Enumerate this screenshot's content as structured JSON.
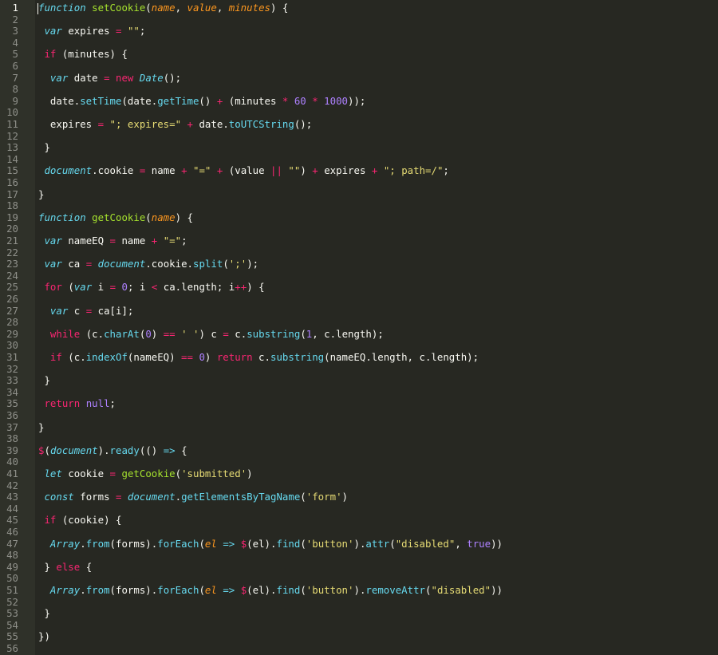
{
  "editor": {
    "theme_colors": {
      "background": "#272822",
      "gutter_background": "#2f3129",
      "line_number": "#8f908a",
      "active_line_number": "#f8f8f2",
      "foreground": "#f8f8f2",
      "keyword": "#f92672",
      "storage": "#66d9ef",
      "entity": "#a6e22e",
      "parameter": "#fd971f",
      "string": "#e6db74",
      "number": "#ae81ff"
    },
    "active_line": 1,
    "lines": [
      {
        "n": "1",
        "tokens": [
          [
            "storage",
            "function"
          ],
          [
            "plain",
            " "
          ],
          [
            "entity",
            "setCookie"
          ],
          [
            "plain",
            "("
          ],
          [
            "param",
            "name"
          ],
          [
            "plain",
            ", "
          ],
          [
            "param",
            "value"
          ],
          [
            "plain",
            ", "
          ],
          [
            "param",
            "minutes"
          ],
          [
            "plain",
            ") {"
          ]
        ]
      },
      {
        "n": "2",
        "tokens": []
      },
      {
        "n": "3",
        "tokens": [
          [
            "plain",
            " "
          ],
          [
            "storage",
            "var"
          ],
          [
            "plain",
            " expires "
          ],
          [
            "keyword",
            "="
          ],
          [
            "plain",
            " "
          ],
          [
            "string",
            "\"\""
          ],
          [
            "plain",
            ";"
          ]
        ]
      },
      {
        "n": "4",
        "tokens": []
      },
      {
        "n": "5",
        "tokens": [
          [
            "plain",
            " "
          ],
          [
            "keyword",
            "if"
          ],
          [
            "plain",
            " (minutes) {"
          ]
        ]
      },
      {
        "n": "6",
        "tokens": []
      },
      {
        "n": "7",
        "tokens": [
          [
            "plain",
            "  "
          ],
          [
            "storage",
            "var"
          ],
          [
            "plain",
            " date "
          ],
          [
            "keyword",
            "="
          ],
          [
            "plain",
            " "
          ],
          [
            "keyword",
            "new"
          ],
          [
            "plain",
            " "
          ],
          [
            "builtin",
            "Date"
          ],
          [
            "plain",
            "();"
          ]
        ]
      },
      {
        "n": "8",
        "tokens": []
      },
      {
        "n": "9",
        "tokens": [
          [
            "plain",
            "  date."
          ],
          [
            "support",
            "setTime"
          ],
          [
            "plain",
            "(date."
          ],
          [
            "support",
            "getTime"
          ],
          [
            "plain",
            "() "
          ],
          [
            "keyword",
            "+"
          ],
          [
            "plain",
            " (minutes "
          ],
          [
            "keyword",
            "*"
          ],
          [
            "plain",
            " "
          ],
          [
            "number",
            "60"
          ],
          [
            "plain",
            " "
          ],
          [
            "keyword",
            "*"
          ],
          [
            "plain",
            " "
          ],
          [
            "number",
            "1000"
          ],
          [
            "plain",
            "));"
          ]
        ]
      },
      {
        "n": "10",
        "tokens": []
      },
      {
        "n": "11",
        "tokens": [
          [
            "plain",
            "  expires "
          ],
          [
            "keyword",
            "="
          ],
          [
            "plain",
            " "
          ],
          [
            "string",
            "\"; expires=\""
          ],
          [
            "plain",
            " "
          ],
          [
            "keyword",
            "+"
          ],
          [
            "plain",
            " date."
          ],
          [
            "support",
            "toUTCString"
          ],
          [
            "plain",
            "();"
          ]
        ]
      },
      {
        "n": "12",
        "tokens": []
      },
      {
        "n": "13",
        "tokens": [
          [
            "plain",
            " }"
          ]
        ]
      },
      {
        "n": "14",
        "tokens": []
      },
      {
        "n": "15",
        "tokens": [
          [
            "plain",
            " "
          ],
          [
            "builtin",
            "document"
          ],
          [
            "plain",
            ".cookie "
          ],
          [
            "keyword",
            "="
          ],
          [
            "plain",
            " name "
          ],
          [
            "keyword",
            "+"
          ],
          [
            "plain",
            " "
          ],
          [
            "string",
            "\"=\""
          ],
          [
            "plain",
            " "
          ],
          [
            "keyword",
            "+"
          ],
          [
            "plain",
            " (value "
          ],
          [
            "keyword",
            "||"
          ],
          [
            "plain",
            " "
          ],
          [
            "string",
            "\"\""
          ],
          [
            "plain",
            ") "
          ],
          [
            "keyword",
            "+"
          ],
          [
            "plain",
            " expires "
          ],
          [
            "keyword",
            "+"
          ],
          [
            "plain",
            " "
          ],
          [
            "string",
            "\"; path=/\""
          ],
          [
            "plain",
            ";"
          ]
        ]
      },
      {
        "n": "16",
        "tokens": []
      },
      {
        "n": "17",
        "tokens": [
          [
            "plain",
            "}"
          ]
        ]
      },
      {
        "n": "18",
        "tokens": []
      },
      {
        "n": "19",
        "tokens": [
          [
            "storage",
            "function"
          ],
          [
            "plain",
            " "
          ],
          [
            "entity",
            "getCookie"
          ],
          [
            "plain",
            "("
          ],
          [
            "param",
            "name"
          ],
          [
            "plain",
            ") {"
          ]
        ]
      },
      {
        "n": "20",
        "tokens": []
      },
      {
        "n": "21",
        "tokens": [
          [
            "plain",
            " "
          ],
          [
            "storage",
            "var"
          ],
          [
            "plain",
            " nameEQ "
          ],
          [
            "keyword",
            "="
          ],
          [
            "plain",
            " name "
          ],
          [
            "keyword",
            "+"
          ],
          [
            "plain",
            " "
          ],
          [
            "string",
            "\"=\""
          ],
          [
            "plain",
            ";"
          ]
        ]
      },
      {
        "n": "22",
        "tokens": []
      },
      {
        "n": "23",
        "tokens": [
          [
            "plain",
            " "
          ],
          [
            "storage",
            "var"
          ],
          [
            "plain",
            " ca "
          ],
          [
            "keyword",
            "="
          ],
          [
            "plain",
            " "
          ],
          [
            "builtin",
            "document"
          ],
          [
            "plain",
            ".cookie."
          ],
          [
            "support",
            "split"
          ],
          [
            "plain",
            "("
          ],
          [
            "string",
            "';'"
          ],
          [
            "plain",
            ");"
          ]
        ]
      },
      {
        "n": "24",
        "tokens": []
      },
      {
        "n": "25",
        "tokens": [
          [
            "plain",
            " "
          ],
          [
            "keyword",
            "for"
          ],
          [
            "plain",
            " ("
          ],
          [
            "storage",
            "var"
          ],
          [
            "plain",
            " i "
          ],
          [
            "keyword",
            "="
          ],
          [
            "plain",
            " "
          ],
          [
            "number",
            "0"
          ],
          [
            "plain",
            "; i "
          ],
          [
            "keyword",
            "<"
          ],
          [
            "plain",
            " ca.length; i"
          ],
          [
            "keyword",
            "++"
          ],
          [
            "plain",
            ") {"
          ]
        ]
      },
      {
        "n": "26",
        "tokens": []
      },
      {
        "n": "27",
        "tokens": [
          [
            "plain",
            "  "
          ],
          [
            "storage",
            "var"
          ],
          [
            "plain",
            " c "
          ],
          [
            "keyword",
            "="
          ],
          [
            "plain",
            " ca[i];"
          ]
        ]
      },
      {
        "n": "28",
        "tokens": []
      },
      {
        "n": "29",
        "tokens": [
          [
            "plain",
            "  "
          ],
          [
            "keyword",
            "while"
          ],
          [
            "plain",
            " (c."
          ],
          [
            "support",
            "charAt"
          ],
          [
            "plain",
            "("
          ],
          [
            "number",
            "0"
          ],
          [
            "plain",
            ") "
          ],
          [
            "keyword",
            "=="
          ],
          [
            "plain",
            " "
          ],
          [
            "string",
            "' '"
          ],
          [
            "plain",
            ") c "
          ],
          [
            "keyword",
            "="
          ],
          [
            "plain",
            " c."
          ],
          [
            "support",
            "substring"
          ],
          [
            "plain",
            "("
          ],
          [
            "number",
            "1"
          ],
          [
            "plain",
            ", c.length);"
          ]
        ]
      },
      {
        "n": "30",
        "tokens": []
      },
      {
        "n": "31",
        "tokens": [
          [
            "plain",
            "  "
          ],
          [
            "keyword",
            "if"
          ],
          [
            "plain",
            " (c."
          ],
          [
            "support",
            "indexOf"
          ],
          [
            "plain",
            "(nameEQ) "
          ],
          [
            "keyword",
            "=="
          ],
          [
            "plain",
            " "
          ],
          [
            "number",
            "0"
          ],
          [
            "plain",
            ") "
          ],
          [
            "keyword",
            "return"
          ],
          [
            "plain",
            " c."
          ],
          [
            "support",
            "substring"
          ],
          [
            "plain",
            "(nameEQ.length, c.length);"
          ]
        ]
      },
      {
        "n": "32",
        "tokens": []
      },
      {
        "n": "33",
        "tokens": [
          [
            "plain",
            " }"
          ]
        ]
      },
      {
        "n": "34",
        "tokens": []
      },
      {
        "n": "35",
        "tokens": [
          [
            "plain",
            " "
          ],
          [
            "keyword",
            "return"
          ],
          [
            "plain",
            " "
          ],
          [
            "const",
            "null"
          ],
          [
            "plain",
            ";"
          ]
        ]
      },
      {
        "n": "36",
        "tokens": []
      },
      {
        "n": "37",
        "tokens": [
          [
            "plain",
            "}"
          ]
        ]
      },
      {
        "n": "38",
        "tokens": []
      },
      {
        "n": "39",
        "tokens": [
          [
            "keyword",
            "$"
          ],
          [
            "plain",
            "("
          ],
          [
            "builtin",
            "document"
          ],
          [
            "plain",
            ")."
          ],
          [
            "support",
            "ready"
          ],
          [
            "plain",
            "(() "
          ],
          [
            "storage",
            "=>"
          ],
          [
            "plain",
            " {"
          ]
        ]
      },
      {
        "n": "40",
        "tokens": []
      },
      {
        "n": "41",
        "tokens": [
          [
            "plain",
            " "
          ],
          [
            "storage",
            "let"
          ],
          [
            "plain",
            " cookie "
          ],
          [
            "keyword",
            "="
          ],
          [
            "plain",
            " "
          ],
          [
            "entity",
            "getCookie"
          ],
          [
            "plain",
            "("
          ],
          [
            "string",
            "'submitted'"
          ],
          [
            "plain",
            ")"
          ]
        ]
      },
      {
        "n": "42",
        "tokens": []
      },
      {
        "n": "43",
        "tokens": [
          [
            "plain",
            " "
          ],
          [
            "storage",
            "const"
          ],
          [
            "plain",
            " forms "
          ],
          [
            "keyword",
            "="
          ],
          [
            "plain",
            " "
          ],
          [
            "builtin",
            "document"
          ],
          [
            "plain",
            "."
          ],
          [
            "support",
            "getElementsByTagName"
          ],
          [
            "plain",
            "("
          ],
          [
            "string",
            "'form'"
          ],
          [
            "plain",
            ")"
          ]
        ]
      },
      {
        "n": "44",
        "tokens": []
      },
      {
        "n": "45",
        "tokens": [
          [
            "plain",
            " "
          ],
          [
            "keyword",
            "if"
          ],
          [
            "plain",
            " (cookie) {"
          ]
        ]
      },
      {
        "n": "46",
        "tokens": []
      },
      {
        "n": "47",
        "tokens": [
          [
            "plain",
            "  "
          ],
          [
            "builtin",
            "Array"
          ],
          [
            "plain",
            "."
          ],
          [
            "support",
            "from"
          ],
          [
            "plain",
            "(forms)."
          ],
          [
            "support",
            "forEach"
          ],
          [
            "plain",
            "("
          ],
          [
            "param",
            "el"
          ],
          [
            "plain",
            " "
          ],
          [
            "storage",
            "=>"
          ],
          [
            "plain",
            " "
          ],
          [
            "keyword",
            "$"
          ],
          [
            "plain",
            "(el)."
          ],
          [
            "support",
            "find"
          ],
          [
            "plain",
            "("
          ],
          [
            "string",
            "'button'"
          ],
          [
            "plain",
            ")."
          ],
          [
            "support",
            "attr"
          ],
          [
            "plain",
            "("
          ],
          [
            "string",
            "\"disabled\""
          ],
          [
            "plain",
            ", "
          ],
          [
            "const",
            "true"
          ],
          [
            "plain",
            "))"
          ]
        ]
      },
      {
        "n": "48",
        "tokens": []
      },
      {
        "n": "49",
        "tokens": [
          [
            "plain",
            " } "
          ],
          [
            "keyword",
            "else"
          ],
          [
            "plain",
            " {"
          ]
        ]
      },
      {
        "n": "50",
        "tokens": []
      },
      {
        "n": "51",
        "tokens": [
          [
            "plain",
            "  "
          ],
          [
            "builtin",
            "Array"
          ],
          [
            "plain",
            "."
          ],
          [
            "support",
            "from"
          ],
          [
            "plain",
            "(forms)."
          ],
          [
            "support",
            "forEach"
          ],
          [
            "plain",
            "("
          ],
          [
            "param",
            "el"
          ],
          [
            "plain",
            " "
          ],
          [
            "storage",
            "=>"
          ],
          [
            "plain",
            " "
          ],
          [
            "keyword",
            "$"
          ],
          [
            "plain",
            "(el)."
          ],
          [
            "support",
            "find"
          ],
          [
            "plain",
            "("
          ],
          [
            "string",
            "'button'"
          ],
          [
            "plain",
            ")."
          ],
          [
            "support",
            "removeAttr"
          ],
          [
            "plain",
            "("
          ],
          [
            "string",
            "\"disabled\""
          ],
          [
            "plain",
            "))"
          ]
        ]
      },
      {
        "n": "52",
        "tokens": []
      },
      {
        "n": "53",
        "tokens": [
          [
            "plain",
            " }"
          ]
        ]
      },
      {
        "n": "54",
        "tokens": []
      },
      {
        "n": "55",
        "tokens": [
          [
            "plain",
            "})"
          ]
        ]
      },
      {
        "n": "56",
        "tokens": []
      }
    ]
  }
}
